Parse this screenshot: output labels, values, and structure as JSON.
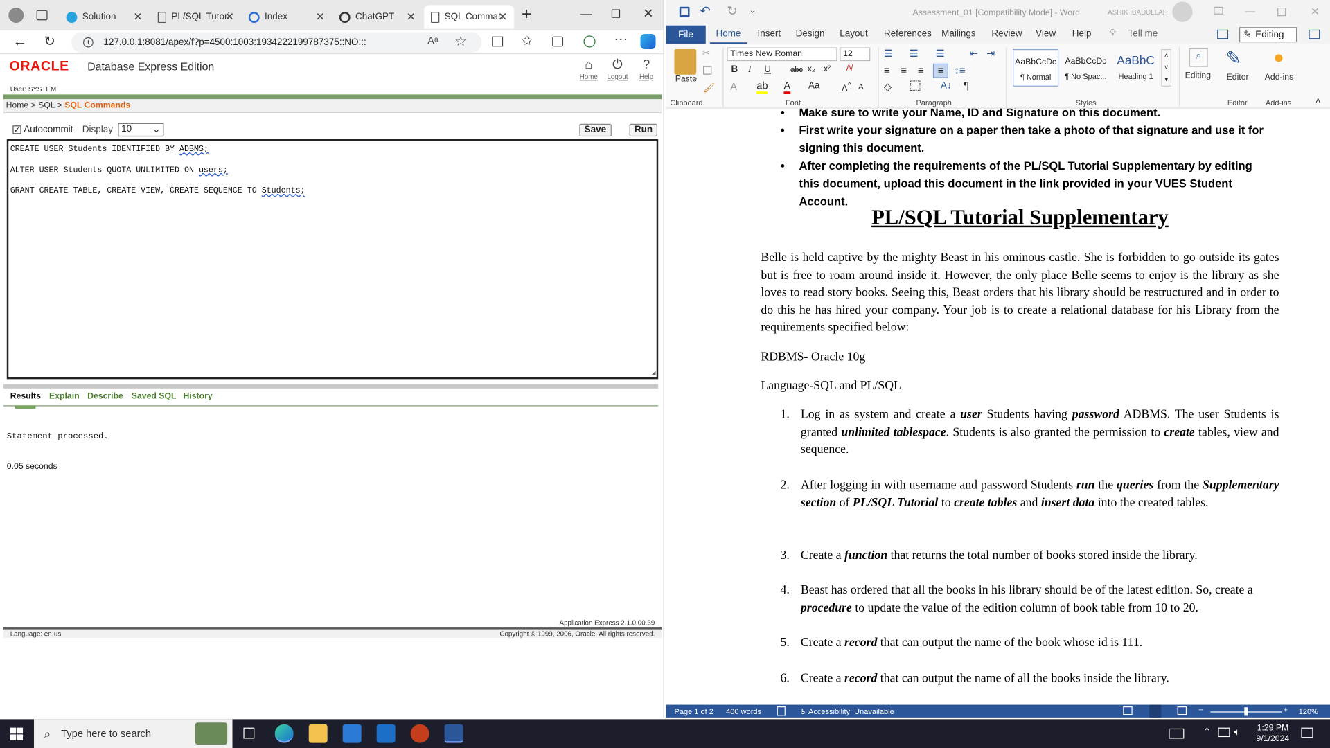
{
  "browser": {
    "tabs": [
      {
        "label": "Solution",
        "icon": "telegram-icon"
      },
      {
        "label": "PL/SQL Tutori",
        "icon": "page-icon"
      },
      {
        "label": "Index",
        "icon": "globe-icon"
      },
      {
        "label": "ChatGPT",
        "icon": "chatgpt-icon"
      },
      {
        "label": "SQL Comman",
        "icon": "page-icon"
      }
    ],
    "url": "127.0.0.1:8081/apex/f?p=4500:1003:1934222199787375::NO:::"
  },
  "apex": {
    "brand": "ORACLE",
    "product": "Database Express Edition",
    "nav": {
      "home": "Home",
      "logout": "Logout",
      "help": "Help"
    },
    "user": "User: SYSTEM",
    "breadcrumb": {
      "home": "Home",
      "sql": "SQL",
      "current": "SQL Commands"
    },
    "autocommit_label": "Autocommit",
    "display_label": "Display",
    "display_value": "10",
    "save_label": "Save",
    "run_label": "Run",
    "editor_lines": [
      {
        "pre": "CREATE USER Students IDENTIFIED BY ",
        "err": "ADBMS;"
      },
      {
        "pre": "ALTER USER Students QUOTA UNLIMITED ON ",
        "err": "users;"
      },
      {
        "pre": "GRANT CREATE TABLE, CREATE VIEW, CREATE SEQUENCE TO ",
        "err": "Students;"
      }
    ],
    "result_tabs": [
      "Results",
      "Explain",
      "Describe",
      "Saved SQL",
      "History"
    ],
    "result": "Statement processed.",
    "timing": "0.05 seconds",
    "version": "Application Express 2.1.0.00.39",
    "language": "Language: en-us",
    "copyright": "Copyright © 1999, 2006, Oracle. All rights reserved."
  },
  "word": {
    "title": "Assessment_01 [Compatibility Mode] - Word",
    "user": "ASHIK IBADULLAH",
    "ribbon_tabs": [
      "File",
      "Home",
      "Insert",
      "Design",
      "Layout",
      "References",
      "Mailings",
      "Review",
      "View",
      "Help",
      "Tell me"
    ],
    "editing_label": "Editing",
    "font_name": "Times New Roman",
    "font_size": "12",
    "styles": [
      {
        "sample": "AaBbCcDc",
        "name": "¶ Normal"
      },
      {
        "sample": "AaBbCcDc",
        "name": "¶ No Spac..."
      },
      {
        "sample": "AaBbC",
        "name": "Heading 1"
      }
    ],
    "groups": {
      "clipboard": "Clipboard",
      "font": "Font",
      "paragraph": "Paragraph",
      "styles": "Styles",
      "editor": "Editor",
      "addins": "Add-ins"
    },
    "paste_label": "Paste",
    "editing_btn": "Editing",
    "editor_btn": "Editor",
    "addins_btn": "Add-ins",
    "bullets": [
      "Make sure to write your Name, ID and Signature on this document.",
      "First write your signature on a paper then take a photo of that signature and use it for signing this document.",
      "After completing the requirements of the  PL/SQL Tutorial Supplementary by editing this document, upload this document in the link provided in your VUES Student Account."
    ],
    "heading": "PL/SQL Tutorial Supplementary",
    "intro": "Belle is held captive by the mighty Beast in his ominous castle. She is forbidden to go outside its gates but is free to roam around inside it. However, the only place Belle seems to enjoy is the library as she loves to read story books. Seeing this, Beast orders that his library should be restructured and in order to do this he has hired your company. Your job is to create a relational database for his Library from the requirements specified below:",
    "rdbms": "RDBMS- Oracle 10g",
    "language": "Language-SQL and PL/SQL",
    "status": {
      "page": "Page 1 of 2",
      "words": "400 words",
      "accessibility": "Accessibility: Unavailable",
      "zoom": "120%"
    }
  },
  "taskbar": {
    "search_placeholder": "Type here to search",
    "time": "1:29 PM",
    "date": "9/1/2024"
  }
}
